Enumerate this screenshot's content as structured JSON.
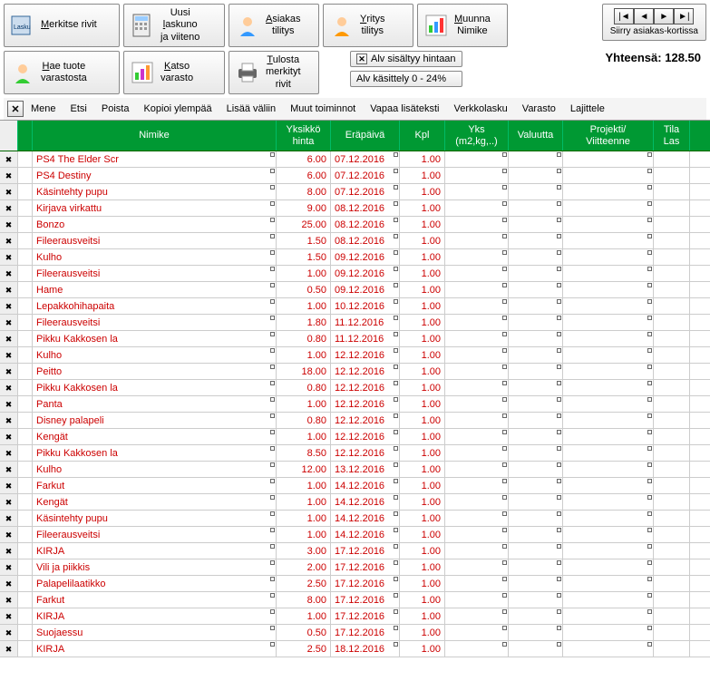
{
  "toolbar": {
    "row1": [
      {
        "icon": "lasku",
        "label": "Merkitse rivit",
        "u": "M"
      },
      {
        "icon": "calc",
        "label": "Uusi laskuno ja viiteno",
        "u": "l"
      },
      {
        "icon": "person-blue",
        "label": "Asiakas tilitys",
        "u": "A"
      },
      {
        "icon": "person-orange",
        "label": "Yritys tilitys",
        "u": "Y"
      },
      {
        "icon": "chart",
        "label": "Muunna Nimike",
        "u": "M"
      }
    ],
    "row2": [
      {
        "icon": "person-green",
        "label": "Hae tuote varastosta",
        "u": "H"
      },
      {
        "icon": "chart2",
        "label": "Katso varasto",
        "u": "K"
      },
      {
        "icon": "printer",
        "label": "Tulosta merkityt rivit",
        "u": "T"
      }
    ]
  },
  "nav": {
    "label": "Siirry asiakas-kortissa"
  },
  "alv": {
    "check": "Alv sisältyy hintaan",
    "rate": "Alv käsittely 0 - 24%"
  },
  "total": {
    "label": "Yhteensä:",
    "value": "128.50"
  },
  "menu": [
    "Mene",
    "Etsi",
    "Poista",
    "Kopioi ylempää",
    "Lisää väliin",
    "Muut toiminnot",
    "Vapaa lisäteksti",
    "Verkkolasku",
    "Varasto",
    "Lajittele"
  ],
  "headers": {
    "name": "Nimike",
    "price": "Yksikkö hinta",
    "date": "Eräpäivä",
    "kpl": "Kpl",
    "yks": "Yks",
    "yks2": "(m2,kg,..)",
    "val": "Valuutta",
    "proj": "Projekti/",
    "proj2": "Viitteenne",
    "tila": "Tila",
    "tila2": "Las"
  },
  "rows": [
    {
      "n": "PS4 The Elder Scr",
      "p": "6.00",
      "d": "07.12.2016",
      "k": "1.00"
    },
    {
      "n": "PS4 Destiny",
      "p": "6.00",
      "d": "07.12.2016",
      "k": "1.00"
    },
    {
      "n": "Käsintehty pupu",
      "p": "8.00",
      "d": "07.12.2016",
      "k": "1.00"
    },
    {
      "n": "Kirjava virkattu",
      "p": "9.00",
      "d": "08.12.2016",
      "k": "1.00"
    },
    {
      "n": "Bonzo",
      "p": "25.00",
      "d": "08.12.2016",
      "k": "1.00"
    },
    {
      "n": "Fileerausveitsi",
      "p": "1.50",
      "d": "08.12.2016",
      "k": "1.00"
    },
    {
      "n": "Kulho",
      "p": "1.50",
      "d": "09.12.2016",
      "k": "1.00"
    },
    {
      "n": "Fileerausveitsi",
      "p": "1.00",
      "d": "09.12.2016",
      "k": "1.00"
    },
    {
      "n": "Hame",
      "p": "0.50",
      "d": "09.12.2016",
      "k": "1.00"
    },
    {
      "n": "Lepakkohihapaita",
      "p": "1.00",
      "d": "10.12.2016",
      "k": "1.00"
    },
    {
      "n": "Fileerausveitsi",
      "p": "1.80",
      "d": "11.12.2016",
      "k": "1.00"
    },
    {
      "n": "Pikku Kakkosen la",
      "p": "0.80",
      "d": "11.12.2016",
      "k": "1.00"
    },
    {
      "n": "Kulho",
      "p": "1.00",
      "d": "12.12.2016",
      "k": "1.00"
    },
    {
      "n": "Peitto",
      "p": "18.00",
      "d": "12.12.2016",
      "k": "1.00"
    },
    {
      "n": "Pikku Kakkosen la",
      "p": "0.80",
      "d": "12.12.2016",
      "k": "1.00"
    },
    {
      "n": "Panta",
      "p": "1.00",
      "d": "12.12.2016",
      "k": "1.00"
    },
    {
      "n": "Disney palapeli",
      "p": "0.80",
      "d": "12.12.2016",
      "k": "1.00"
    },
    {
      "n": "Kengät",
      "p": "1.00",
      "d": "12.12.2016",
      "k": "1.00"
    },
    {
      "n": "Pikku Kakkosen la",
      "p": "8.50",
      "d": "12.12.2016",
      "k": "1.00"
    },
    {
      "n": "Kulho",
      "p": "12.00",
      "d": "13.12.2016",
      "k": "1.00"
    },
    {
      "n": "Farkut",
      "p": "1.00",
      "d": "14.12.2016",
      "k": "1.00"
    },
    {
      "n": "Kengät",
      "p": "1.00",
      "d": "14.12.2016",
      "k": "1.00"
    },
    {
      "n": "Käsintehty pupu",
      "p": "1.00",
      "d": "14.12.2016",
      "k": "1.00"
    },
    {
      "n": "Fileerausveitsi",
      "p": "1.00",
      "d": "14.12.2016",
      "k": "1.00"
    },
    {
      "n": "KIRJA",
      "p": "3.00",
      "d": "17.12.2016",
      "k": "1.00"
    },
    {
      "n": "Vili ja piikkis",
      "p": "2.00",
      "d": "17.12.2016",
      "k": "1.00"
    },
    {
      "n": "Palapelilaatikko",
      "p": "2.50",
      "d": "17.12.2016",
      "k": "1.00"
    },
    {
      "n": "Farkut",
      "p": "8.00",
      "d": "17.12.2016",
      "k": "1.00"
    },
    {
      "n": "KIRJA",
      "p": "1.00",
      "d": "17.12.2016",
      "k": "1.00"
    },
    {
      "n": "Suojaessu",
      "p": "0.50",
      "d": "17.12.2016",
      "k": "1.00"
    },
    {
      "n": "KIRJA",
      "p": "2.50",
      "d": "18.12.2016",
      "k": "1.00"
    }
  ]
}
